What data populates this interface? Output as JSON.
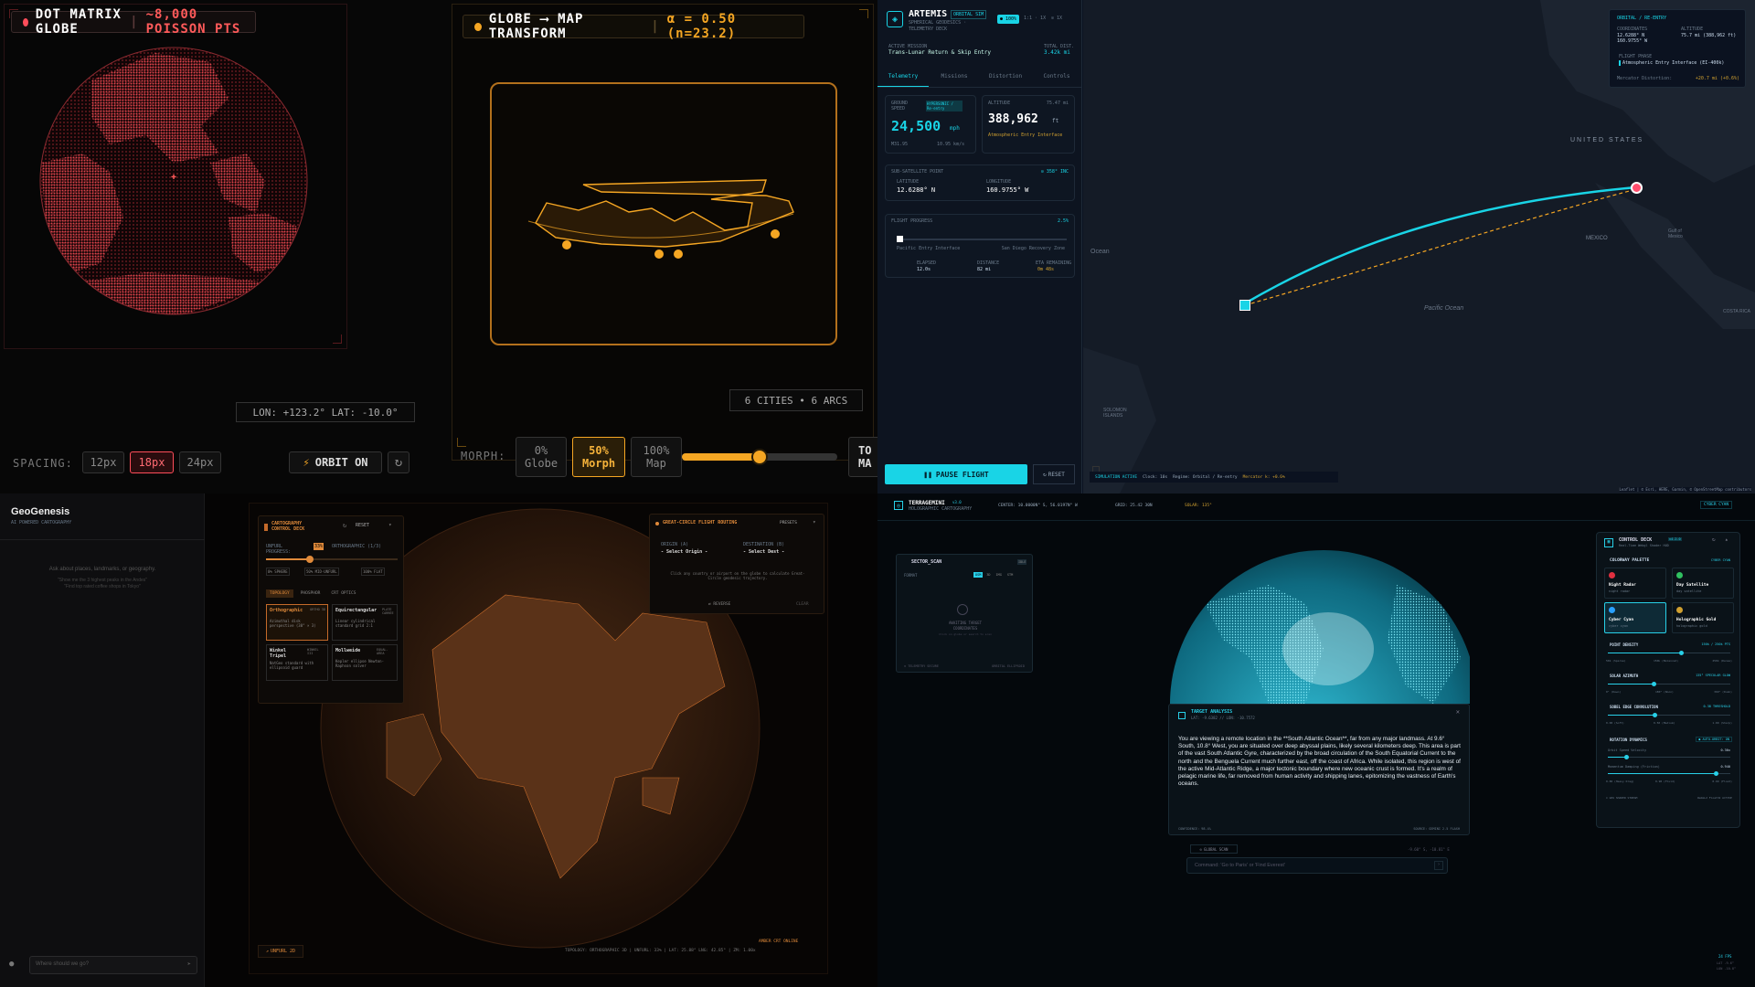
{
  "colors": {
    "q1_accent": "#ff4d5a",
    "q1_globe": "#c8323a",
    "q1_orange": "#f5a623",
    "q2_cyan": "#19d4e6",
    "q2_red": "#ff4d6d",
    "q3_orange": "#c46a2a",
    "q4_cyan": "#28d0e8"
  },
  "q1": {
    "globe_panel": {
      "title": "DOT MATRIX GLOBE",
      "subtitle": "~8,000 POISSON PTS",
      "coords": "LON: +123.2° LAT: -10.0°",
      "spacing_label": "SPACING:",
      "spacing_options": [
        "12px",
        "18px",
        "24px"
      ],
      "spacing_selected": "18px",
      "orbit_label": "ORBIT ON",
      "orbit_icon": "bolt-icon",
      "reset_icon": "refresh-icon"
    },
    "transform_panel": {
      "title": "GLOBE ⟶ MAP TRANSFORM",
      "alpha": "α = 0.50 (n=23.2)",
      "cities": "6 CITIES • 6 ARCS",
      "morph_label": "MORPH:",
      "morph_options": [
        {
          "pct": "0%",
          "name": "Globe"
        },
        {
          "pct": "50%",
          "name": "Morph"
        },
        {
          "pct": "100%",
          "name": "Map"
        }
      ],
      "morph_selected": "50%",
      "slider_value": 0.5,
      "toggle_label": "TO MA"
    }
  },
  "q2": {
    "brand": "ARTEMIS",
    "badge": "ORBITAL SIM",
    "subtitle_1": "SPHERICAL GEODESICS ·",
    "subtitle_2": "TELEMETRY DECK",
    "status_chip": "● 100%",
    "counter": "1:1 · 1X",
    "rate": "⊙ 1X",
    "mission_label": "ACTIVE MISSION",
    "mission": "Trans-Lunar Return & Skip Entry",
    "total_label": "TOTAL DIST.",
    "total": "3.42k mi",
    "tabs": [
      "Telemetry",
      "Missions",
      "Distortion",
      "Controls"
    ],
    "tab_active": "Telemetry",
    "speed": {
      "label": "GROUND SPEED",
      "badge": "HYPERSONIC / Re-entry",
      "value": "24,500",
      "unit": "mph",
      "sub1": "M31.95",
      "sub2": "10.95 km/s"
    },
    "altitude": {
      "label": "ALTITUDE",
      "right": "75.47 mi",
      "value": "388,962",
      "unit": "ft",
      "sub": "Atmospheric Entry Interface"
    },
    "subpoint": {
      "label": "SUB-SATELLITE POINT",
      "right": "⊙ 358° INC",
      "lat_label": "LATITUDE",
      "lat": "12.6288° N",
      "lon_label": "LONGITUDE",
      "lon": "160.9755° W"
    },
    "progress": {
      "label": "FLIGHT PROGRESS",
      "pct": "2.5%",
      "value": 0.025,
      "from": "Pacific Entry Interface",
      "to": "San Diego Recovery Zone",
      "elapsed_label": "ELAPSED",
      "elapsed": "12.0s",
      "distance_label": "DISTANCE",
      "distance": "82 mi",
      "eta_label": "ETA REMAINING",
      "eta": "0m 48s"
    },
    "pause_button": "PAUSE FLIGHT",
    "reset_button": "RESET",
    "status_bar": {
      "active": "SIMULATION ACTIVE",
      "clock": "Clock: 10s",
      "regime": "Regime: Orbital / Re-entry",
      "mercator": "Mercator k: +0.6%",
      "attribution": "Leaflet | © Esri, HERE, Garmin, © OpenStreetMap contributors"
    },
    "map_labels": {
      "us": "UNITED STATES",
      "mexico": "MEXICO",
      "pacific": "Pacific Ocean",
      "ocean_left": "Ocean",
      "solomon": "SOLOMON ISLANDS",
      "costa": "COSTA RICA",
      "gulf": "Gulf of Mexico"
    },
    "overlay": {
      "title": "ORBITAL / RE-ENTRY",
      "alt_label": "ALTITUDE",
      "alt": "75.7 mi (388,962 ft)",
      "coord_label": "COORDINATES",
      "coord": "12.6288° N",
      "coord2": "160.9755° W",
      "phase_label": "FLIGHT PHASE",
      "phase": "Atmospheric Entry Interface (EI-400k)",
      "merc_label": "Mercator Distortion:",
      "merc": "+20.7 mi (+0.6%)"
    }
  },
  "q3": {
    "brand": "GeoGenesis",
    "tagline": "AI POWERED CARTOGRAPHY",
    "prompt_1": "Ask about places, landmarks, or geography.",
    "prompt_2": "\"Show me the 3 highest peaks in the Andes\"",
    "prompt_3": "\"Find top rated coffee shops in Tokyo\"",
    "chat_placeholder": "Where should we go?",
    "control": {
      "title_1": "CARTOGRAPHY",
      "title_2": "CONTROL DECK",
      "reset": "RESET",
      "unfurl_label": "UNFURL PROGRESS:",
      "unfurl_pct": "33%",
      "unfurl_value": 0.33,
      "unfurl_note": "ORTHOGRAPHIC (1/3)",
      "marks": [
        "0% SPHERE",
        "50% MID-UNFURL",
        "100% FLAT"
      ],
      "tabs": [
        "TOPOLOGY",
        "PHOSPHOR",
        "CRT OPTICS"
      ],
      "tab_active": "TOPOLOGY",
      "projections": [
        {
          "name": "Orthographic",
          "tag": "ORTHO 3D",
          "desc": "Azimuthal disk perspective (30° × 3)"
        },
        {
          "name": "Equirectangular",
          "tag": "PLATE CARRÉE",
          "desc": "Linear cylindrical standard grid 2:1"
        },
        {
          "name": "Winkel Tripel",
          "tag": "WINKEL III",
          "desc": "NatGeo standard with ellipsoid guard"
        },
        {
          "name": "Mollweide",
          "tag": "EQUAL-AREA",
          "desc": "Kepler ellipse Newton-Raphson solver"
        }
      ],
      "active_projection": "Orthographic"
    },
    "routing": {
      "title": "GREAT-CIRCLE FLIGHT ROUTING",
      "presets": "PRESETS",
      "origin_label": "ORIGIN (A)",
      "origin": "- Select Origin -",
      "dest_label": "DESTINATION (B)",
      "dest": "- Select Dest -",
      "hint": "Click any country or airport on the globe to calculate Great-Circle geodesic trajectory.",
      "reverse": "⇄ REVERSE",
      "clear": "CLEAR"
    },
    "unfurl_button": "UNFURL 2D",
    "crt_status": "AMBER CRT ONLINE",
    "status_bar": "TOPOLOGY: ORTHOGRAPHIC 3D | UNFURL: 33% | LAT: 25.88° LNG: 42.85° | ZM: 1.00x"
  },
  "q4": {
    "brand": "TERRAGEMINI",
    "version": "v3.0",
    "brand_sub": "HOLOGRAPHIC CARTOGRAPHY",
    "center": "CENTER: 10.0000N° S, 56.0197N° W",
    "grid": "GRID: 25.42 30N",
    "solar": "SOLAR: 135°",
    "theme": "CYBER CYAN",
    "sector": {
      "title": "SECTOR_SCAN",
      "badge": "IDLE",
      "format_label": "FORMAT",
      "formats": [
        "OSM",
        "3D",
        "IMG",
        "STM"
      ],
      "awaiting_1": "AWAITING TARGET",
      "awaiting_2": "COORDINATES",
      "hint": "Click on globe or search to scan",
      "footer_left": "⊙ TELEMETRY SECURE",
      "footer_right": "ORBITAL ELLIPSOID"
    },
    "analysis": {
      "title": "TARGET ANALYSIS",
      "coords": "LAT: -9.6382 // LON: -10.7572",
      "text": "You are viewing a remote location in the **South Atlantic Ocean**, far from any major landmass. At 9.6° South, 10.8° West, you are situated over deep abyssal plains, likely several kilometers deep. This area is part of the vast South Atlantic Gyre, characterized by the broad circulation of the South Equatorial Current to the north and the Benguela Current much further east, off the coast of Africa. While isolated, this region is west of the active Mid-Atlantic Ridge, a major tectonic boundary where new oceanic crust is formed. It's a realm of pelagic marine life, far removed from human activity and shipping lanes, epitomizing the vastness of Earth's oceans.",
      "foot_left": "CONFIDENCE: 98.4%",
      "foot_right": "SOURCE: GEMINI 2.5 FLASH"
    },
    "control": {
      "title": "CONTROL DECK",
      "ver": "v4.2.0",
      "sub": "Real-Time Webgl Shader HUD",
      "palette_title": "COLORWAY PALETTE",
      "palette_right": "CYBER CYAN",
      "swatches": [
        {
          "name": "Night Radar",
          "sub": "night radar",
          "color": "#e03040"
        },
        {
          "name": "Day Satellite",
          "sub": "day satellite",
          "color": "#30c060"
        },
        {
          "name": "Cyber Cyan",
          "sub": "cyber cyan",
          "color": "#2aa0ff"
        },
        {
          "name": "Holographic Gold",
          "sub": "holographic gold",
          "color": "#d0a030"
        }
      ],
      "point_density": {
        "label": "POINT DENSITY",
        "right": "150k / 250k PTS",
        "value": 0.6,
        "l": "50k (Sparse)",
        "m": "150k (Balanced)",
        "r": "250k (Dense)"
      },
      "solar": {
        "label": "SOLAR AZIMUTH",
        "right": "135° SPECULAR GLOW",
        "value": 0.37,
        "l": "0° (Dawn)",
        "m": "180° (Noon)",
        "r": "360° (Dusk)"
      },
      "sobel": {
        "label": "SOBEL EDGE CONVOLUTION",
        "right": "0.38 THRESHOLD",
        "value": 0.38,
        "l": "0.00 (Soft)",
        "m": "0.50 (Medium)",
        "r": "1.00 (Sharp)"
      },
      "rotation": {
        "label": "ROTATION DYNAMICS",
        "right": "● AUTO-ORBIT: ON",
        "orbit_label": "Orbit Speed Velocity",
        "orbit": "0.30x",
        "orbit_value": 0.15,
        "damp_label": "Momentum Damping (Friction)",
        "damp": "0.940",
        "damp_value": 0.88,
        "l": "0.80 (Heavy Drag)",
        "m": "0.90 (Fluid)",
        "r": "0.99 (Float)"
      },
      "footer_left": "⊙ GPU SHADER STREAM",
      "footer_right": "WebGL2 Float32 ACTIVE"
    },
    "global_scan": "GLOBAL SCAN",
    "scan_coords": "-9.60° S, -10.81° E",
    "command_placeholder": "Command: 'Go to Paris' or 'Find Everest'",
    "fps": "24 FPS",
    "corner_1": "LAT -9.6°",
    "corner_2": "LON -10.8°"
  }
}
